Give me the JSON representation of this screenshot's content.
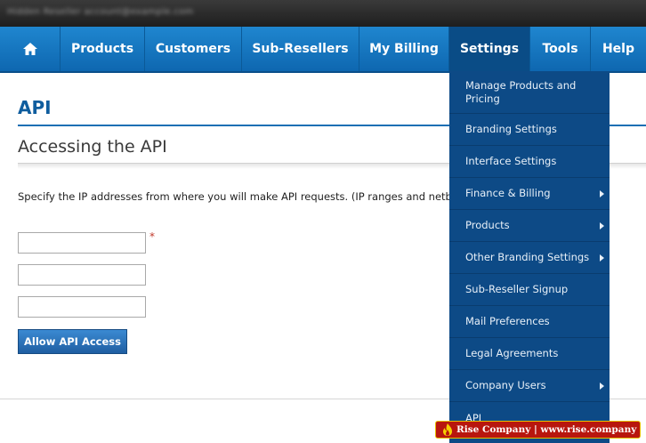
{
  "topbar": {
    "user_text": "Hidden Reseller account@example.com"
  },
  "nav": {
    "home_icon": "home-icon",
    "items": [
      {
        "label": "Products"
      },
      {
        "label": "Customers"
      },
      {
        "label": "Sub-Resellers"
      },
      {
        "label": "My Billing"
      },
      {
        "label": "Settings",
        "active": true
      },
      {
        "label": "Tools"
      },
      {
        "label": "Help"
      }
    ]
  },
  "page": {
    "title": "API",
    "section_title": "Accessing the API",
    "description": "Specify the IP addresses from where you will make API requests. (IP ranges and netbloc",
    "required_marker": "*",
    "inputs": [
      {
        "value": ""
      },
      {
        "value": ""
      },
      {
        "value": ""
      }
    ],
    "button_label": "Allow API Access"
  },
  "settings_menu": {
    "items": [
      {
        "label": "Manage Products and Pricing",
        "has_submenu": false
      },
      {
        "label": "Branding Settings",
        "has_submenu": false
      },
      {
        "label": "Interface Settings",
        "has_submenu": false
      },
      {
        "label": "Finance & Billing",
        "has_submenu": true
      },
      {
        "label": "Products",
        "has_submenu": true
      },
      {
        "label": "Other Branding Settings",
        "has_submenu": true
      },
      {
        "label": "Sub-Reseller Signup",
        "has_submenu": false
      },
      {
        "label": "Mail Preferences",
        "has_submenu": false
      },
      {
        "label": "Legal Agreements",
        "has_submenu": false
      },
      {
        "label": "Company Users",
        "has_submenu": true
      },
      {
        "label": "API",
        "has_submenu": false
      }
    ]
  },
  "watermark": {
    "text": "Rise Company | www.rise.company"
  },
  "colors": {
    "nav_blue": "#1574c0",
    "menu_blue": "#0d4a86",
    "title_blue": "#0f5d9e"
  }
}
